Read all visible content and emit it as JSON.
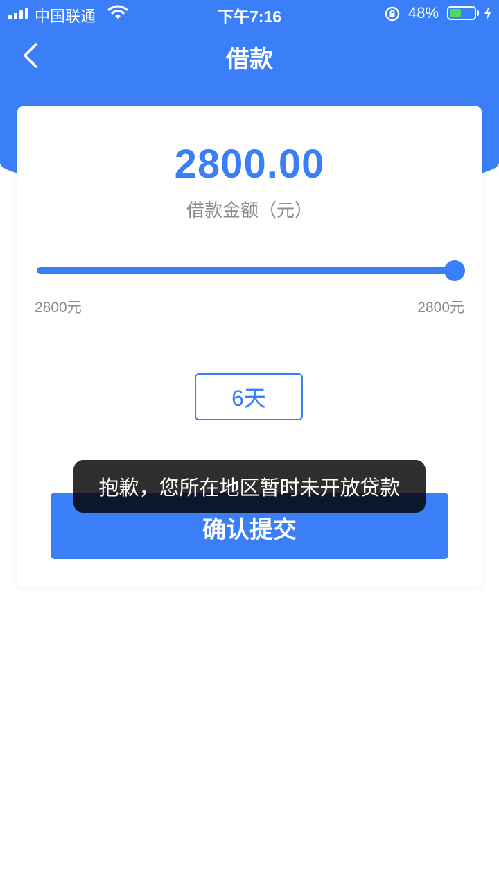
{
  "status_bar": {
    "carrier": "中国联通",
    "time": "下午7:16",
    "battery_percent": "48%",
    "battery_level": 0.48,
    "icons": [
      "signal-icon",
      "wifi-icon",
      "rotation-lock-icon",
      "battery-icon",
      "charging-bolt-icon"
    ]
  },
  "nav": {
    "title": "借款",
    "back_icon": "chevron-left-icon"
  },
  "loan": {
    "amount": "2800.00",
    "amount_label": "借款金额（元）",
    "slider_min_label": "2800元",
    "slider_max_label": "2800元",
    "slider_value_fraction": 1.0,
    "term_label": "6天",
    "submit_label": "确认提交"
  },
  "toast": {
    "message": "抱歉，您所在地区暂时未开放贷款"
  },
  "colors": {
    "primary": "#3a7ff7",
    "text_muted": "#8c8c8c",
    "toast_bg": "#000000",
    "battery_fill": "#4cd964"
  }
}
